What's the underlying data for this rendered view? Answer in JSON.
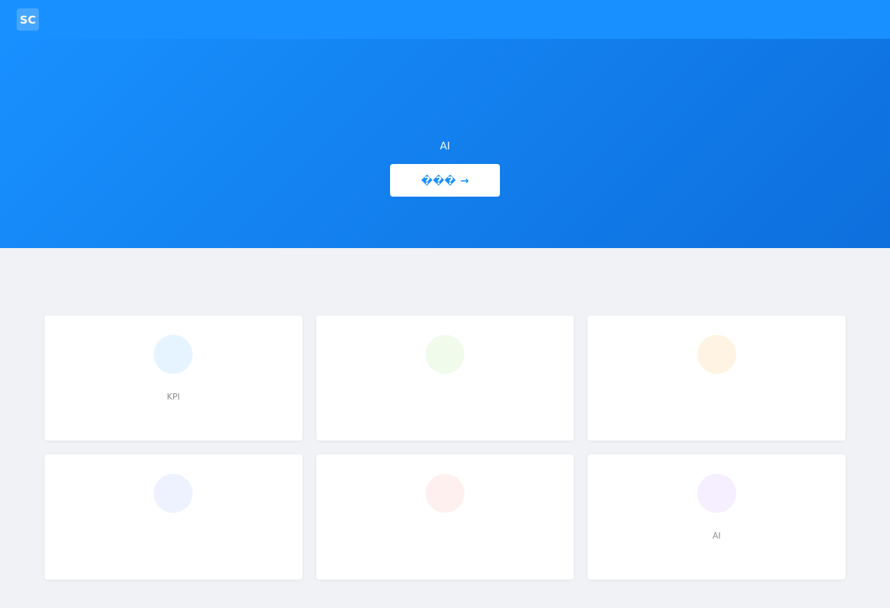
{
  "header": {
    "logo_text": "SC",
    "app_name": "",
    "nav": [
      {
        "label": ""
      },
      {
        "label": ""
      }
    ]
  },
  "hero": {
    "title": "",
    "subtitle": "AI",
    "button_label": "���",
    "button_arrow": "→"
  },
  "features": {
    "title": "",
    "cards": [
      {
        "icon": "",
        "icon_name": "feature-icon-1",
        "icon_bg": "#e6f4ff",
        "title": "",
        "description": "KPI"
      },
      {
        "icon": "",
        "icon_name": "feature-icon-2",
        "icon_bg": "#f0fbeb",
        "title": "",
        "description": ""
      },
      {
        "icon": "",
        "icon_name": "feature-icon-3",
        "icon_bg": "#fff4e3",
        "title": "",
        "description": ""
      },
      {
        "icon": "",
        "icon_name": "feature-icon-4",
        "icon_bg": "#eef2ff",
        "title": "",
        "description": ""
      },
      {
        "icon": "",
        "icon_name": "feature-icon-5",
        "icon_bg": "#fff0f0",
        "title": "",
        "description": ""
      },
      {
        "icon": "",
        "icon_name": "feature-icon-6",
        "icon_bg": "#f5efff",
        "title": "",
        "description": "AI"
      }
    ]
  },
  "colors": {
    "primary": "#1890ff",
    "background": "#f0f2f5"
  }
}
